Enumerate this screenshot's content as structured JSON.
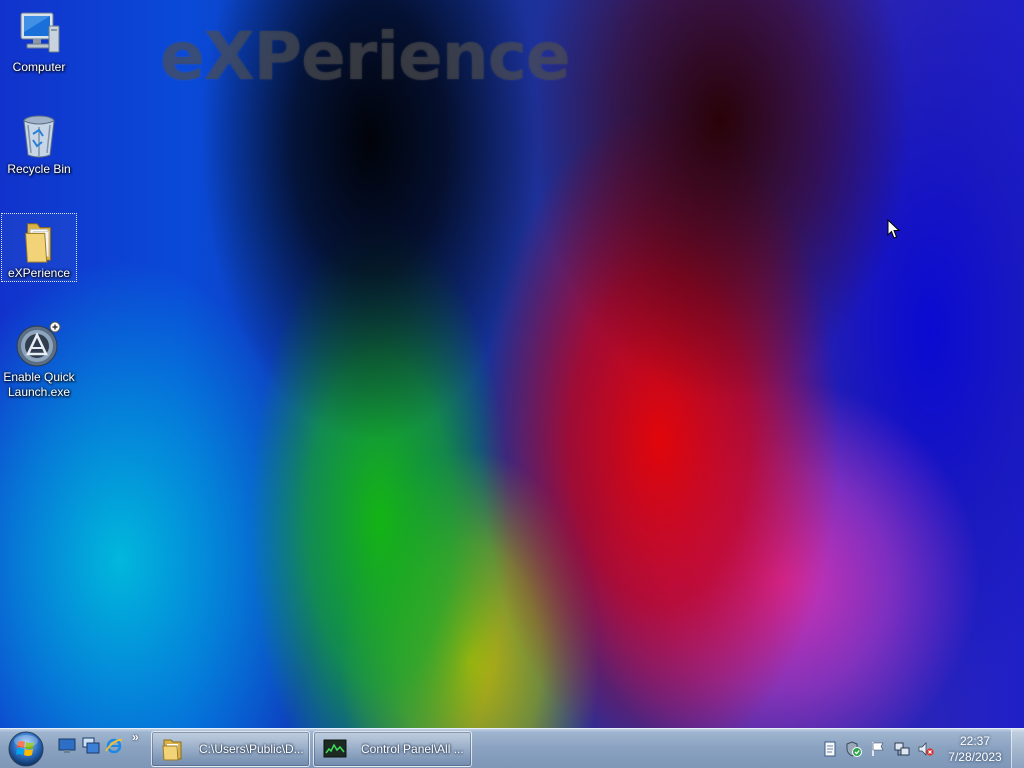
{
  "desktop": {
    "watermark": "eXPerience",
    "icons": [
      {
        "label": "Computer",
        "icon": "computer-icon"
      },
      {
        "label": "Recycle Bin",
        "icon": "recycle-bin-icon"
      },
      {
        "label": "eXPerience",
        "icon": "folder-icon",
        "selected": true
      },
      {
        "label": "Enable Quick\nLaunch.exe",
        "icon": "app-launcher-icon"
      }
    ]
  },
  "taskbar": {
    "quick_launch": [
      {
        "icon": "show-desktop-icon"
      },
      {
        "icon": "switch-windows-icon"
      },
      {
        "icon": "internet-explorer-icon"
      }
    ],
    "quick_launch_more": "»",
    "tasks": [
      {
        "label": "C:\\Users\\Public\\D...",
        "icon": "folder-icon"
      },
      {
        "label": "Control Panel\\All ...",
        "icon": "control-panel-icon"
      }
    ],
    "tray_icons": [
      "notepad-icon",
      "security-shield-icon",
      "action-center-flag-icon",
      "network-icon",
      "volume-muted-icon"
    ],
    "clock": {
      "time": "22:37",
      "date": "7/28/2023"
    }
  },
  "colors": {
    "taskbar": "#8aa2c0",
    "desktop_red": "#e0050a",
    "desktop_blue": "#1010d2",
    "desktop_green": "#14b414"
  }
}
